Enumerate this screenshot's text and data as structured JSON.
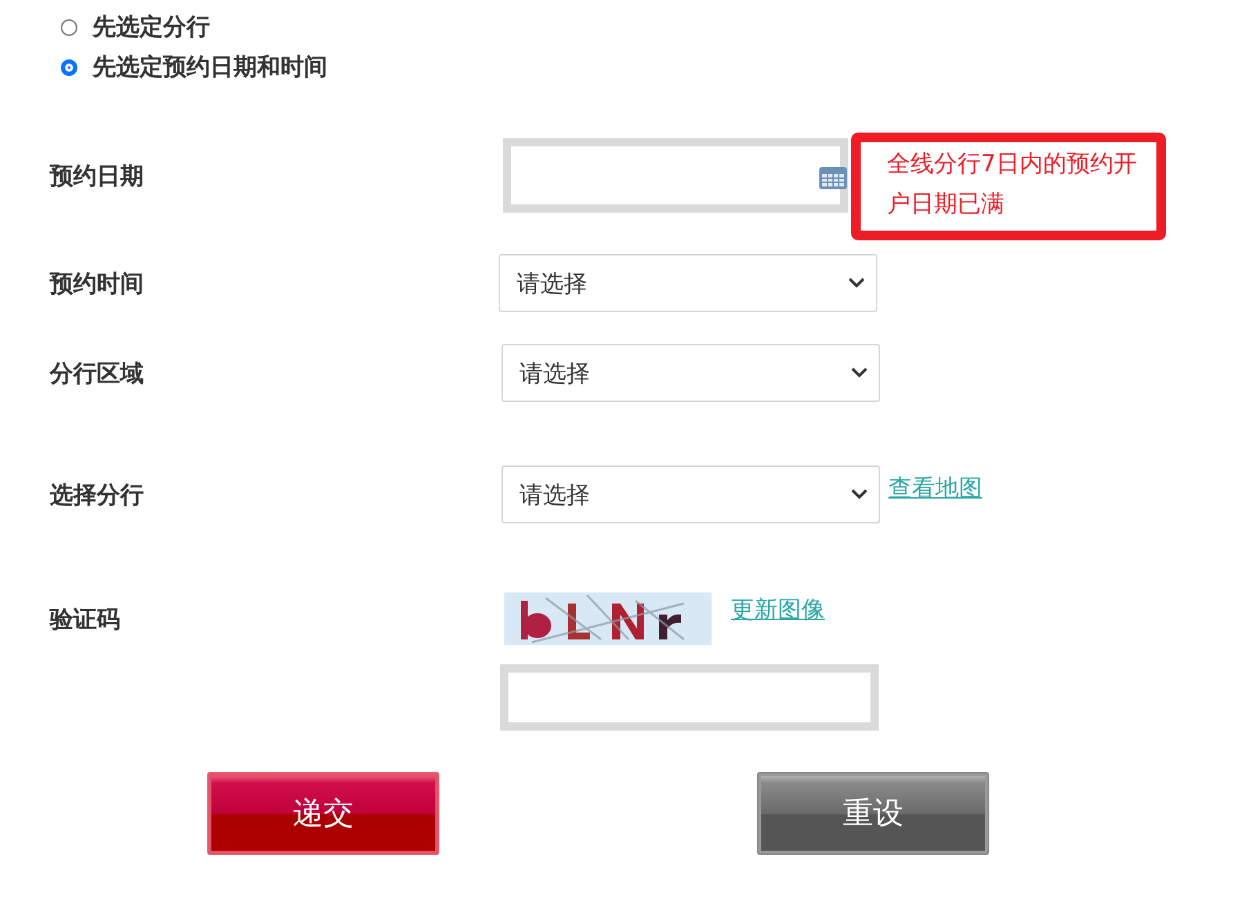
{
  "mode_options": [
    {
      "label": "先选定分行",
      "selected": false
    },
    {
      "label": "先选定预约日期和时间",
      "selected": true
    }
  ],
  "date": {
    "label": "预约日期",
    "notice": "全线分行7日内的预约开户日期已满"
  },
  "time": {
    "label": "预约时间",
    "value": "请选择"
  },
  "region": {
    "label": "分行区域",
    "value": "请选择"
  },
  "branch": {
    "label": "选择分行",
    "value": "请选择",
    "link": "查看地图"
  },
  "captcha": {
    "label": "验证码",
    "link": "更新图像"
  },
  "buttons": [
    {
      "label": "递交",
      "kind": "submit"
    },
    {
      "label": "重设",
      "kind": "reset"
    }
  ]
}
